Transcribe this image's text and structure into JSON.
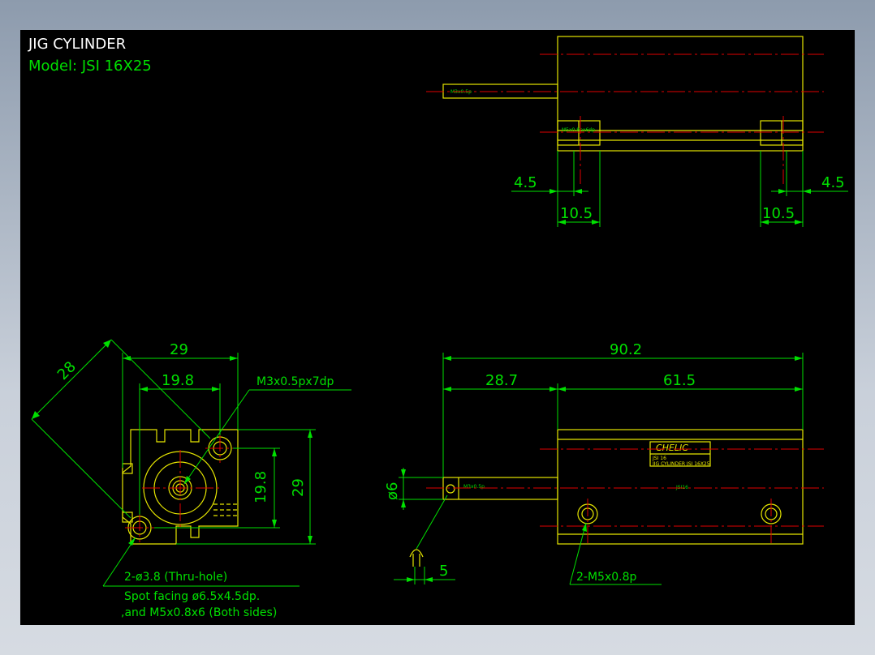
{
  "title": {
    "name": "JIG CYLINDER",
    "model": "Model:  JSI 16X25"
  },
  "colors": {
    "outline": "#e6e600",
    "dimension": "#00e000",
    "centerline": "#e00000",
    "title": "#ffffff",
    "background": "#000000"
  },
  "top_view": {
    "port_label": "M3x0.5p",
    "tap_label": "M5x0.8px6dp",
    "dims": {
      "left_offset": "4.5",
      "right_offset": "4.5",
      "left_width": "10.5",
      "right_width": "10.5"
    }
  },
  "end_view": {
    "dims": {
      "diag": "28",
      "width": "29",
      "hole_pitch_h": "19.8",
      "hole_pitch_v": "19.8",
      "height": "29"
    },
    "tap_note": "M3x0.5px7dp",
    "hole_note": "2-ø3.8 (Thru-hole)",
    "spot_note_1": "Spot facing ø6.5x4.5dp.",
    "spot_note_2": ",and M5x0.8x6 (Both sides)"
  },
  "side_view": {
    "dims": {
      "overall": "90.2",
      "rod_length": "28.7",
      "body_length": "61.5",
      "rod_dia": "ø6",
      "rod_end": "5"
    },
    "port_label": "M3x0.5p",
    "port_note": "2-M5x0.8p",
    "nameplate": {
      "brand": "CHELIC",
      "line1": "JSI 16",
      "line2": "JIG CYLINDER  JSI 16X25"
    },
    "body_label": "JSI16"
  }
}
